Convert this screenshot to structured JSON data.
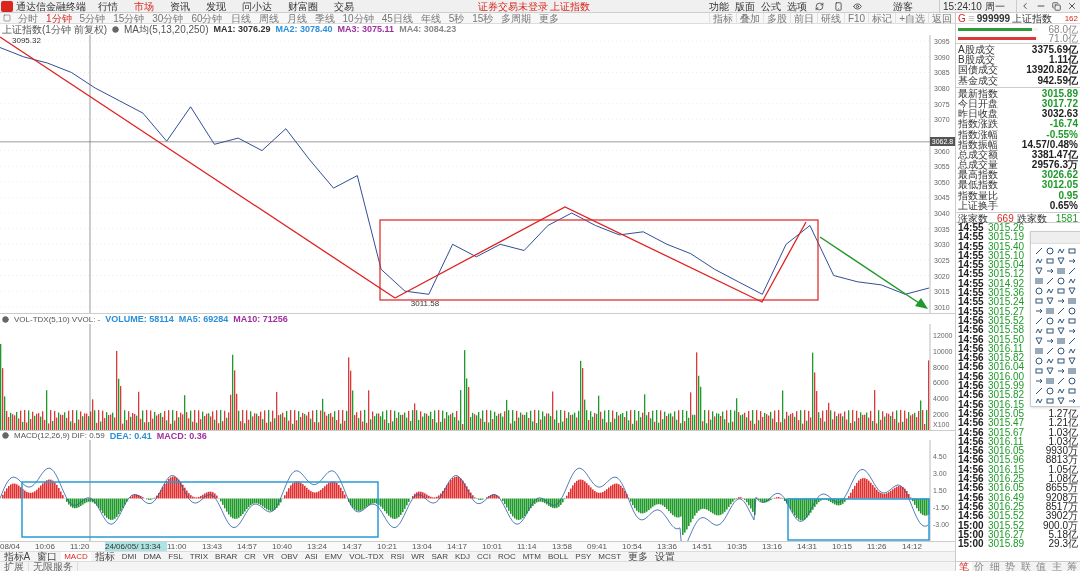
{
  "menu": {
    "app_title": "通达信金融终端",
    "items": [
      {
        "label": "行情",
        "selected": false
      },
      {
        "label": "市场",
        "selected": true
      },
      {
        "label": "资讯",
        "selected": false
      },
      {
        "label": "发现",
        "selected": false
      },
      {
        "label": "问小达",
        "selected": false
      },
      {
        "label": "财富圈",
        "selected": false
      },
      {
        "label": "交易",
        "selected": false
      }
    ],
    "notice": "证券交易未登录 上证指数",
    "right_items": [
      "功能",
      "版面",
      "公式",
      "选项"
    ],
    "guest": "游客",
    "clock": "15:24:10 周一"
  },
  "periods": [
    {
      "label": "分时",
      "selected": false
    },
    {
      "label": "1分钟",
      "selected": true
    },
    {
      "label": "5分钟",
      "selected": false
    },
    {
      "label": "15分钟",
      "selected": false
    },
    {
      "label": "30分钟",
      "selected": false
    },
    {
      "label": "60分钟",
      "selected": false
    },
    {
      "label": "日线",
      "selected": false
    },
    {
      "label": "周线",
      "selected": false
    },
    {
      "label": "月线",
      "selected": false
    },
    {
      "label": "季线",
      "selected": false
    },
    {
      "label": "10分钟",
      "selected": false
    },
    {
      "label": "45日线",
      "selected": false
    },
    {
      "label": "年线",
      "selected": false
    },
    {
      "label": "5秒",
      "selected": false
    },
    {
      "label": "15秒",
      "selected": false
    },
    {
      "label": "多周期",
      "selected": false
    },
    {
      "label": "更多",
      "selected": false
    }
  ],
  "chart_tools": [
    "指标",
    "叠加",
    "多股",
    "前日",
    "研线",
    "F10",
    "标记",
    "+自选",
    "返回"
  ],
  "price_panel": {
    "title": "上证指数(1分钟 前复权)",
    "crosshair_label": "3062.8",
    "indicator": "MA均(5,13,20,250)",
    "ma_values": [
      {
        "text": "MA1: 3076.29",
        "color": "#333333"
      },
      {
        "text": "MA2: 3078.40",
        "color": "#2b8fd8"
      },
      {
        "text": "MA3: 3075.11",
        "color": "#a030a0"
      },
      {
        "text": "MA4: 3084.23",
        "color": "#888888"
      }
    ],
    "chart_data": {
      "type": "line",
      "grid": true,
      "values": [
        3093,
        3090,
        3088,
        3085,
        3080,
        3076,
        3072,
        3063,
        3074,
        3062,
        3064,
        3060,
        3067,
        3057,
        3048,
        3052,
        3022,
        3015,
        3014,
        3030,
        3026,
        3030,
        3028,
        3036,
        3040,
        3036,
        3033,
        3034,
        3030,
        3027,
        3022,
        3018,
        3014,
        3030,
        3036,
        3020,
        3018,
        3017,
        3014,
        3016
      ],
      "ylim": [
        3008,
        3097
      ],
      "yticks": [
        3010,
        3015,
        3020,
        3025,
        3030,
        3035,
        3040,
        3045,
        3050,
        3055,
        3060,
        3070,
        3075,
        3080,
        3085,
        3090,
        3095
      ],
      "annotations": [
        "3095.32",
        "3011.58"
      ]
    }
  },
  "volume_panel": {
    "title": "VOL-TDX(5,10) VVOL: -",
    "values": [
      {
        "text": "VOLUME: 58114",
        "color": "#2b8fd8"
      },
      {
        "text": "MA5: 69284",
        "color": "#2b8fd8"
      },
      {
        "text": "MA10: 71256",
        "color": "#a030a0"
      }
    ],
    "axis_labels": [
      "12000",
      "10000",
      "8000",
      "6000",
      "4000",
      "2000"
    ],
    "unit": "X100"
  },
  "macd_panel": {
    "title": "MACD(12,26,9) DIF: 0.59",
    "values": [
      {
        "text": "DEA: 0.41",
        "color": "#2b8fd8"
      },
      {
        "text": "MACD: 0.36",
        "color": "#a030a0"
      }
    ],
    "axis_labels": [
      "4.50",
      "3.00",
      "1.50",
      "-1.50",
      "-3.00"
    ]
  },
  "time_axis": [
    "08/04",
    "10:06",
    "11:20",
    "24/06/05/ 13:34",
    "11:00",
    "13:43",
    "14:57",
    "10:40",
    "13:24",
    "14:37",
    "10:21",
    "13:04",
    "14:17",
    "10:01",
    "11:14",
    "13:58",
    "09:41",
    "10:54",
    "13:36",
    "14:51",
    "10:35",
    "13:16",
    "14:31",
    "10:15",
    "11:26",
    "14:12"
  ],
  "indicators": [
    {
      "label": "指标A",
      "selected": false
    },
    {
      "label": "窗口",
      "selected": false
    },
    {
      "label": "MACD",
      "selected": true
    },
    {
      "label": "指标",
      "selected": false
    },
    {
      "label": "DMI",
      "selected": false
    },
    {
      "label": "DMA",
      "selected": false
    },
    {
      "label": "FSL",
      "selected": false
    },
    {
      "label": "TRIX",
      "selected": false
    },
    {
      "label": "BRAR",
      "selected": false
    },
    {
      "label": "CR",
      "selected": false
    },
    {
      "label": "VR",
      "selected": false
    },
    {
      "label": "OBV",
      "selected": false
    },
    {
      "label": "ASI",
      "selected": false
    },
    {
      "label": "EMV",
      "selected": false
    },
    {
      "label": "VOL-TDX",
      "selected": false
    },
    {
      "label": "RSI",
      "selected": false
    },
    {
      "label": "WR",
      "selected": false
    },
    {
      "label": "SAR",
      "selected": false
    },
    {
      "label": "KDJ",
      "selected": false
    },
    {
      "label": "CCI",
      "selected": false
    },
    {
      "label": "ROC",
      "selected": false
    },
    {
      "label": "MTM",
      "selected": false
    },
    {
      "label": "BOLL",
      "selected": false
    },
    {
      "label": "PSY",
      "selected": false
    },
    {
      "label": "MCST",
      "selected": false
    },
    {
      "label": "更多",
      "selected": false
    },
    {
      "label": "设置",
      "selected": false
    }
  ],
  "bottom_bar": [
    "扩展",
    "无限服务"
  ],
  "quote_panel": {
    "market_mark": "G",
    "code": "999999",
    "name": "上证指数",
    "badge": "162",
    "ratio_bars": [
      {
        "label": "68.0亿",
        "level": 0.93,
        "color": "#2e9a3a"
      },
      {
        "label": "71.0亿",
        "level": 0.97,
        "color": "#d83a3a"
      }
    ],
    "turnover": [
      {
        "label": "A股成交",
        "value": "3375.69亿",
        "color": "#222222"
      },
      {
        "label": "B股成交",
        "value": "1.11亿",
        "color": "#222222"
      },
      {
        "label": "国债成交",
        "value": "13920.82亿",
        "color": "#222222"
      },
      {
        "label": "基金成交",
        "value": "942.59亿",
        "color": "#222222"
      }
    ],
    "stats": [
      {
        "label": "最新指数",
        "value": "3015.89",
        "color": "#1f9a2a"
      },
      {
        "label": "今日开盘",
        "value": "3017.72",
        "color": "#1f9a2a"
      },
      {
        "label": "昨日收盘",
        "value": "3032.63",
        "color": "#222222"
      },
      {
        "label": "指数涨跌",
        "value": "-16.74",
        "color": "#1f9a2a"
      },
      {
        "label": "指数涨幅",
        "value": "-0.55%",
        "color": "#1f9a2a"
      },
      {
        "label": "指数振幅",
        "value": "14.57/0.48%",
        "color": "#222222"
      },
      {
        "label": "总成交额",
        "value": "3381.47亿",
        "color": "#222222"
      },
      {
        "label": "总成交量",
        "value": "29576.3万",
        "color": "#222222"
      },
      {
        "label": "最高指数",
        "value": "3026.62",
        "color": "#1f9a2a"
      },
      {
        "label": "最低指数",
        "value": "3012.05",
        "color": "#1f9a2a"
      },
      {
        "label": "指数量比",
        "value": "0.95",
        "color": "#1f9a2a"
      },
      {
        "label": "上证换手",
        "value": "0.65%",
        "color": "#222222"
      }
    ],
    "breadth": {
      "up_label": "涨家数",
      "up_count": "669",
      "down_label": "跌家数",
      "down_count": "1581"
    },
    "ticks": [
      {
        "time": "14:55",
        "price": "3015.26"
      },
      {
        "time": "14:55",
        "price": "3015.19"
      },
      {
        "time": "14:55",
        "price": "3015.40"
      },
      {
        "time": "14:55",
        "price": "3015.10"
      },
      {
        "time": "14:55",
        "price": "3015.04"
      },
      {
        "time": "14:55",
        "price": "3015.12"
      },
      {
        "time": "14:55",
        "price": "3014.92"
      },
      {
        "time": "14:55",
        "price": "3015.36"
      },
      {
        "time": "14:55",
        "price": "3015.24"
      },
      {
        "time": "14:55",
        "price": "3015.27"
      },
      {
        "time": "14:56",
        "price": "3015.52"
      },
      {
        "time": "14:56",
        "price": "3015.58"
      },
      {
        "time": "14:56",
        "price": "3015.50"
      },
      {
        "time": "14:56",
        "price": "3016.11"
      },
      {
        "time": "14:56",
        "price": "3015.82"
      },
      {
        "time": "14:56",
        "price": "3016.04"
      },
      {
        "time": "14:56",
        "price": "3016.00"
      },
      {
        "time": "14:56",
        "price": "3015.99"
      },
      {
        "time": "14:56",
        "price": "3015.82"
      },
      {
        "time": "14:56",
        "price": "3016.15"
      },
      {
        "time": "14:56",
        "price": "3015.05",
        "volume": "1.27亿"
      },
      {
        "time": "14:56",
        "price": "3015.47",
        "volume": "1.21亿"
      },
      {
        "time": "14:56",
        "price": "3015.67",
        "volume": "1.03亿"
      },
      {
        "time": "14:56",
        "price": "3016.11",
        "volume": "1.03亿"
      },
      {
        "time": "14:56",
        "price": "3016.05",
        "volume": "9930万"
      },
      {
        "time": "14:56",
        "price": "3015.96",
        "volume": "8813万"
      },
      {
        "time": "14:56",
        "price": "3016.15",
        "volume": "1.05亿"
      },
      {
        "time": "14:56",
        "price": "3016.25",
        "volume": "1.08亿"
      },
      {
        "time": "14:56",
        "price": "3016.05",
        "volume": "8655万"
      },
      {
        "time": "14:56",
        "price": "3016.49",
        "volume": "9208万"
      },
      {
        "time": "14:56",
        "price": "3016.25",
        "volume": "8517万"
      },
      {
        "time": "14:56",
        "price": "3015.52",
        "volume": "3902万"
      },
      {
        "time": "15:00",
        "price": "3015.52",
        "volume": "900.0万"
      },
      {
        "time": "15:00",
        "price": "3016.27",
        "volume": "5.18亿"
      },
      {
        "time": "15:00",
        "price": "3015.89",
        "volume": "29.3亿"
      }
    ],
    "tabs": [
      {
        "label": "笔",
        "selected": true
      },
      {
        "label": "价",
        "selected": false
      },
      {
        "label": "细",
        "selected": false
      },
      {
        "label": "势",
        "selected": false
      },
      {
        "label": "联",
        "selected": false
      },
      {
        "label": "值",
        "selected": false
      },
      {
        "label": "主",
        "selected": false
      },
      {
        "label": "筹",
        "selected": false
      }
    ]
  }
}
